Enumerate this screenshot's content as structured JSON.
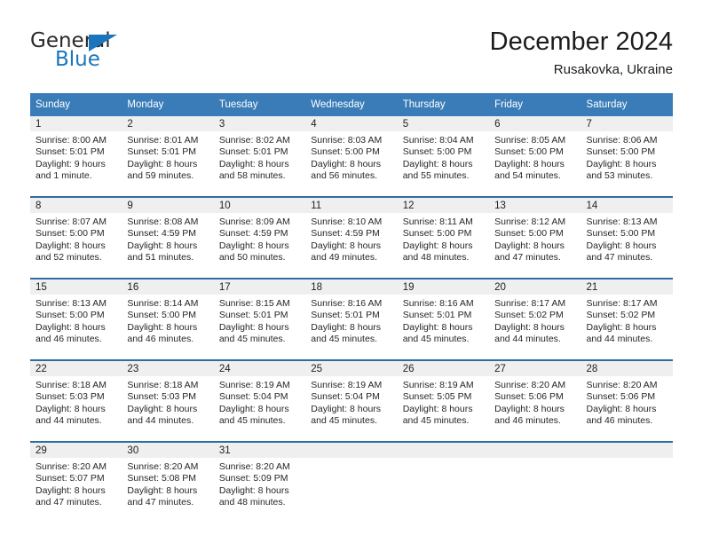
{
  "brand": {
    "name_top": "General",
    "name_bottom": "Blue",
    "accent_color": "#1b75bc",
    "triangle_icon": "blue-triangle-icon"
  },
  "header": {
    "title": "December 2024",
    "subtitle": "Rusakovka, Ukraine"
  },
  "theme": {
    "header_bg": "#3a7cb8",
    "week_divider": "#2e6da4",
    "daynum_band_bg": "#efefef",
    "text": "#262626"
  },
  "weekday_headers": [
    "Sunday",
    "Monday",
    "Tuesday",
    "Wednesday",
    "Thursday",
    "Friday",
    "Saturday"
  ],
  "weeks": [
    [
      {
        "day": "1",
        "sunrise": "Sunrise: 8:00 AM",
        "sunset": "Sunset: 5:01 PM",
        "daylight_1": "Daylight: 9 hours",
        "daylight_2": "and 1 minute."
      },
      {
        "day": "2",
        "sunrise": "Sunrise: 8:01 AM",
        "sunset": "Sunset: 5:01 PM",
        "daylight_1": "Daylight: 8 hours",
        "daylight_2": "and 59 minutes."
      },
      {
        "day": "3",
        "sunrise": "Sunrise: 8:02 AM",
        "sunset": "Sunset: 5:01 PM",
        "daylight_1": "Daylight: 8 hours",
        "daylight_2": "and 58 minutes."
      },
      {
        "day": "4",
        "sunrise": "Sunrise: 8:03 AM",
        "sunset": "Sunset: 5:00 PM",
        "daylight_1": "Daylight: 8 hours",
        "daylight_2": "and 56 minutes."
      },
      {
        "day": "5",
        "sunrise": "Sunrise: 8:04 AM",
        "sunset": "Sunset: 5:00 PM",
        "daylight_1": "Daylight: 8 hours",
        "daylight_2": "and 55 minutes."
      },
      {
        "day": "6",
        "sunrise": "Sunrise: 8:05 AM",
        "sunset": "Sunset: 5:00 PM",
        "daylight_1": "Daylight: 8 hours",
        "daylight_2": "and 54 minutes."
      },
      {
        "day": "7",
        "sunrise": "Sunrise: 8:06 AM",
        "sunset": "Sunset: 5:00 PM",
        "daylight_1": "Daylight: 8 hours",
        "daylight_2": "and 53 minutes."
      }
    ],
    [
      {
        "day": "8",
        "sunrise": "Sunrise: 8:07 AM",
        "sunset": "Sunset: 5:00 PM",
        "daylight_1": "Daylight: 8 hours",
        "daylight_2": "and 52 minutes."
      },
      {
        "day": "9",
        "sunrise": "Sunrise: 8:08 AM",
        "sunset": "Sunset: 4:59 PM",
        "daylight_1": "Daylight: 8 hours",
        "daylight_2": "and 51 minutes."
      },
      {
        "day": "10",
        "sunrise": "Sunrise: 8:09 AM",
        "sunset": "Sunset: 4:59 PM",
        "daylight_1": "Daylight: 8 hours",
        "daylight_2": "and 50 minutes."
      },
      {
        "day": "11",
        "sunrise": "Sunrise: 8:10 AM",
        "sunset": "Sunset: 4:59 PM",
        "daylight_1": "Daylight: 8 hours",
        "daylight_2": "and 49 minutes."
      },
      {
        "day": "12",
        "sunrise": "Sunrise: 8:11 AM",
        "sunset": "Sunset: 5:00 PM",
        "daylight_1": "Daylight: 8 hours",
        "daylight_2": "and 48 minutes."
      },
      {
        "day": "13",
        "sunrise": "Sunrise: 8:12 AM",
        "sunset": "Sunset: 5:00 PM",
        "daylight_1": "Daylight: 8 hours",
        "daylight_2": "and 47 minutes."
      },
      {
        "day": "14",
        "sunrise": "Sunrise: 8:13 AM",
        "sunset": "Sunset: 5:00 PM",
        "daylight_1": "Daylight: 8 hours",
        "daylight_2": "and 47 minutes."
      }
    ],
    [
      {
        "day": "15",
        "sunrise": "Sunrise: 8:13 AM",
        "sunset": "Sunset: 5:00 PM",
        "daylight_1": "Daylight: 8 hours",
        "daylight_2": "and 46 minutes."
      },
      {
        "day": "16",
        "sunrise": "Sunrise: 8:14 AM",
        "sunset": "Sunset: 5:00 PM",
        "daylight_1": "Daylight: 8 hours",
        "daylight_2": "and 46 minutes."
      },
      {
        "day": "17",
        "sunrise": "Sunrise: 8:15 AM",
        "sunset": "Sunset: 5:01 PM",
        "daylight_1": "Daylight: 8 hours",
        "daylight_2": "and 45 minutes."
      },
      {
        "day": "18",
        "sunrise": "Sunrise: 8:16 AM",
        "sunset": "Sunset: 5:01 PM",
        "daylight_1": "Daylight: 8 hours",
        "daylight_2": "and 45 minutes."
      },
      {
        "day": "19",
        "sunrise": "Sunrise: 8:16 AM",
        "sunset": "Sunset: 5:01 PM",
        "daylight_1": "Daylight: 8 hours",
        "daylight_2": "and 45 minutes."
      },
      {
        "day": "20",
        "sunrise": "Sunrise: 8:17 AM",
        "sunset": "Sunset: 5:02 PM",
        "daylight_1": "Daylight: 8 hours",
        "daylight_2": "and 44 minutes."
      },
      {
        "day": "21",
        "sunrise": "Sunrise: 8:17 AM",
        "sunset": "Sunset: 5:02 PM",
        "daylight_1": "Daylight: 8 hours",
        "daylight_2": "and 44 minutes."
      }
    ],
    [
      {
        "day": "22",
        "sunrise": "Sunrise: 8:18 AM",
        "sunset": "Sunset: 5:03 PM",
        "daylight_1": "Daylight: 8 hours",
        "daylight_2": "and 44 minutes."
      },
      {
        "day": "23",
        "sunrise": "Sunrise: 8:18 AM",
        "sunset": "Sunset: 5:03 PM",
        "daylight_1": "Daylight: 8 hours",
        "daylight_2": "and 44 minutes."
      },
      {
        "day": "24",
        "sunrise": "Sunrise: 8:19 AM",
        "sunset": "Sunset: 5:04 PM",
        "daylight_1": "Daylight: 8 hours",
        "daylight_2": "and 45 minutes."
      },
      {
        "day": "25",
        "sunrise": "Sunrise: 8:19 AM",
        "sunset": "Sunset: 5:04 PM",
        "daylight_1": "Daylight: 8 hours",
        "daylight_2": "and 45 minutes."
      },
      {
        "day": "26",
        "sunrise": "Sunrise: 8:19 AM",
        "sunset": "Sunset: 5:05 PM",
        "daylight_1": "Daylight: 8 hours",
        "daylight_2": "and 45 minutes."
      },
      {
        "day": "27",
        "sunrise": "Sunrise: 8:20 AM",
        "sunset": "Sunset: 5:06 PM",
        "daylight_1": "Daylight: 8 hours",
        "daylight_2": "and 46 minutes."
      },
      {
        "day": "28",
        "sunrise": "Sunrise: 8:20 AM",
        "sunset": "Sunset: 5:06 PM",
        "daylight_1": "Daylight: 8 hours",
        "daylight_2": "and 46 minutes."
      }
    ],
    [
      {
        "day": "29",
        "sunrise": "Sunrise: 8:20 AM",
        "sunset": "Sunset: 5:07 PM",
        "daylight_1": "Daylight: 8 hours",
        "daylight_2": "and 47 minutes."
      },
      {
        "day": "30",
        "sunrise": "Sunrise: 8:20 AM",
        "sunset": "Sunset: 5:08 PM",
        "daylight_1": "Daylight: 8 hours",
        "daylight_2": "and 47 minutes."
      },
      {
        "day": "31",
        "sunrise": "Sunrise: 8:20 AM",
        "sunset": "Sunset: 5:09 PM",
        "daylight_1": "Daylight: 8 hours",
        "daylight_2": "and 48 minutes."
      },
      {
        "day": "",
        "sunrise": "",
        "sunset": "",
        "daylight_1": "",
        "daylight_2": ""
      },
      {
        "day": "",
        "sunrise": "",
        "sunset": "",
        "daylight_1": "",
        "daylight_2": ""
      },
      {
        "day": "",
        "sunrise": "",
        "sunset": "",
        "daylight_1": "",
        "daylight_2": ""
      },
      {
        "day": "",
        "sunrise": "",
        "sunset": "",
        "daylight_1": "",
        "daylight_2": ""
      }
    ]
  ]
}
